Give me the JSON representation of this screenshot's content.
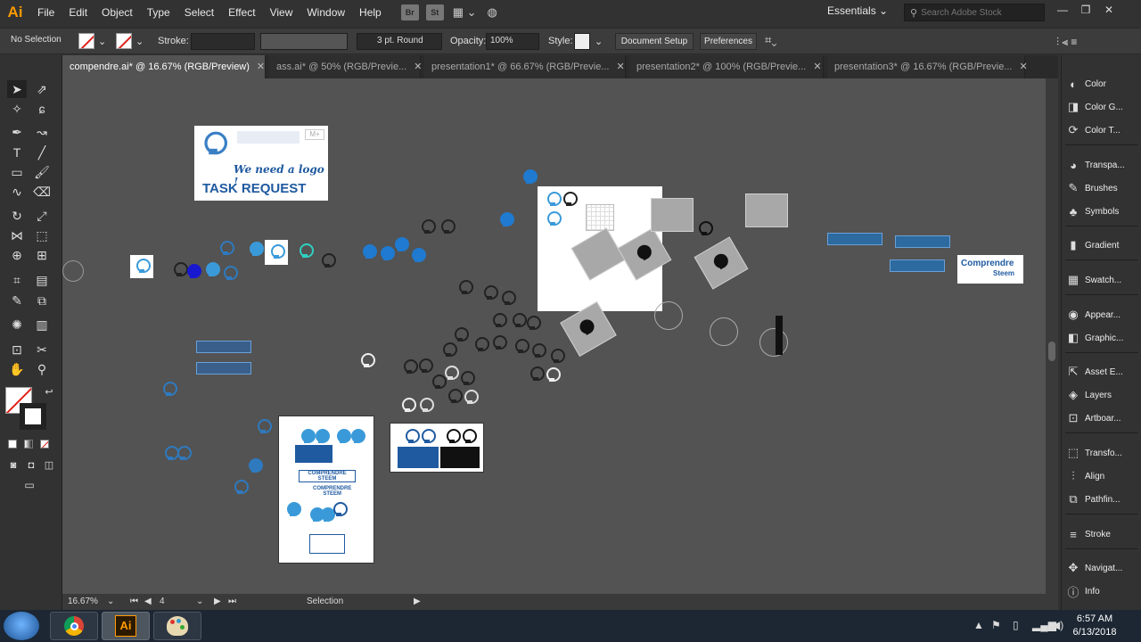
{
  "app": {
    "logo": "Ai"
  },
  "menu": [
    "File",
    "Edit",
    "Object",
    "Type",
    "Select",
    "Effect",
    "View",
    "Window",
    "Help"
  ],
  "menu_icons": [
    "Br",
    "St"
  ],
  "workspace": "Essentials",
  "search": {
    "placeholder": "Search Adobe Stock"
  },
  "control": {
    "selection": "No Selection",
    "stroke_label": "Stroke:",
    "stroke_profile": "3 pt. Round",
    "opacity_label": "Opacity:",
    "opacity_value": "100%",
    "style_label": "Style:",
    "doc_setup": "Document Setup",
    "preferences": "Preferences"
  },
  "tabs": [
    "compendre.ai* @ 16.67% (RGB/Preview)",
    "ass.ai* @ 50% (RGB/Previe...",
    "presentation1* @ 66.67% (RGB/Previe...",
    "presentation2* @ 100% (RGB/Previe...",
    "presentation3* @ 16.67% (RGB/Previe..."
  ],
  "artwork": {
    "task_title": "We need a logo !",
    "task_subtitle": "TASK REQUEST",
    "logo_line1": "Comprendre",
    "logo_line2": "Steem",
    "logo_caps1": "COMPRENDRE",
    "logo_caps2": "STEEM"
  },
  "panels": [
    "Color",
    "Color G...",
    "Color T...",
    "Transpa...",
    "Brushes",
    "Symbols",
    "Gradient",
    "Swatch...",
    "Appear...",
    "Graphic...",
    "Asset E...",
    "Layers",
    "Artboar...",
    "Transfo...",
    "Align",
    "Pathfin...",
    "Stroke",
    "Navigat...",
    "Info"
  ],
  "status": {
    "zoom": "16.67%",
    "artboard": "4",
    "tool": "Selection"
  },
  "taskbar": {
    "time": "6:57 AM",
    "date": "6/13/2018"
  },
  "colors": {
    "accent_orange": "#ff9a00",
    "canvas": "#535353",
    "brand_blue": "#1f5aa0",
    "light_blue": "#3a9ad9"
  }
}
